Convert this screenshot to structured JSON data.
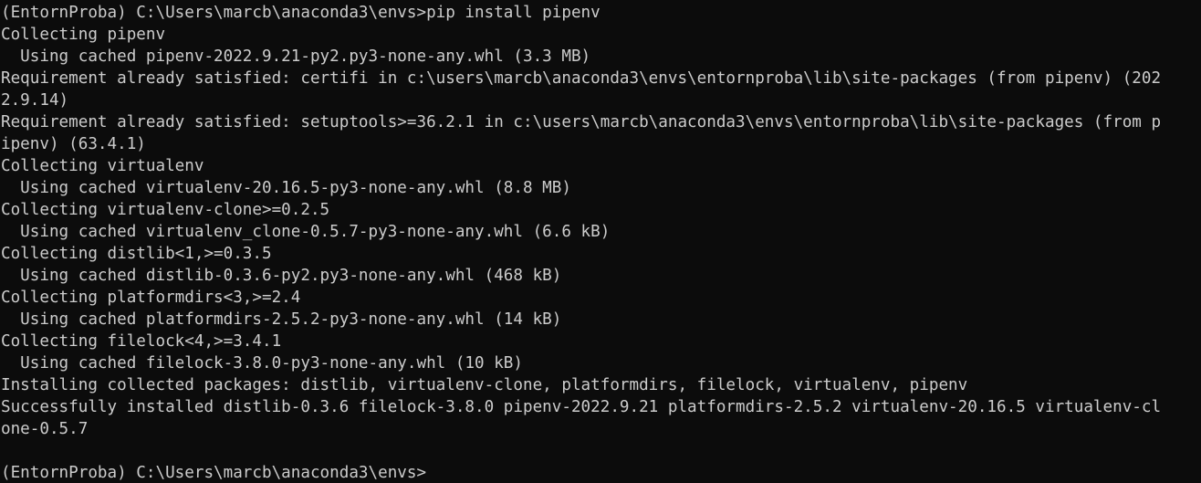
{
  "terminal": {
    "lines": [
      "(EntornProba) C:\\Users\\marcb\\anaconda3\\envs>pip install pipenv",
      "Collecting pipenv",
      "  Using cached pipenv-2022.9.21-py2.py3-none-any.whl (3.3 MB)",
      "Requirement already satisfied: certifi in c:\\users\\marcb\\anaconda3\\envs\\entornproba\\lib\\site-packages (from pipenv) (202",
      "2.9.14)",
      "Requirement already satisfied: setuptools>=36.2.1 in c:\\users\\marcb\\anaconda3\\envs\\entornproba\\lib\\site-packages (from p",
      "ipenv) (63.4.1)",
      "Collecting virtualenv",
      "  Using cached virtualenv-20.16.5-py3-none-any.whl (8.8 MB)",
      "Collecting virtualenv-clone>=0.2.5",
      "  Using cached virtualenv_clone-0.5.7-py3-none-any.whl (6.6 kB)",
      "Collecting distlib<1,>=0.3.5",
      "  Using cached distlib-0.3.6-py2.py3-none-any.whl (468 kB)",
      "Collecting platformdirs<3,>=2.4",
      "  Using cached platformdirs-2.5.2-py3-none-any.whl (14 kB)",
      "Collecting filelock<4,>=3.4.1",
      "  Using cached filelock-3.8.0-py3-none-any.whl (10 kB)",
      "Installing collected packages: distlib, virtualenv-clone, platformdirs, filelock, virtualenv, pipenv",
      "Successfully installed distlib-0.3.6 filelock-3.8.0 pipenv-2022.9.21 platformdirs-2.5.2 virtualenv-20.16.5 virtualenv-cl",
      "one-0.5.7",
      "",
      "(EntornProba) C:\\Users\\marcb\\anaconda3\\envs>"
    ]
  },
  "colors": {
    "background": "#0c0c0c",
    "foreground": "#cccccc"
  }
}
